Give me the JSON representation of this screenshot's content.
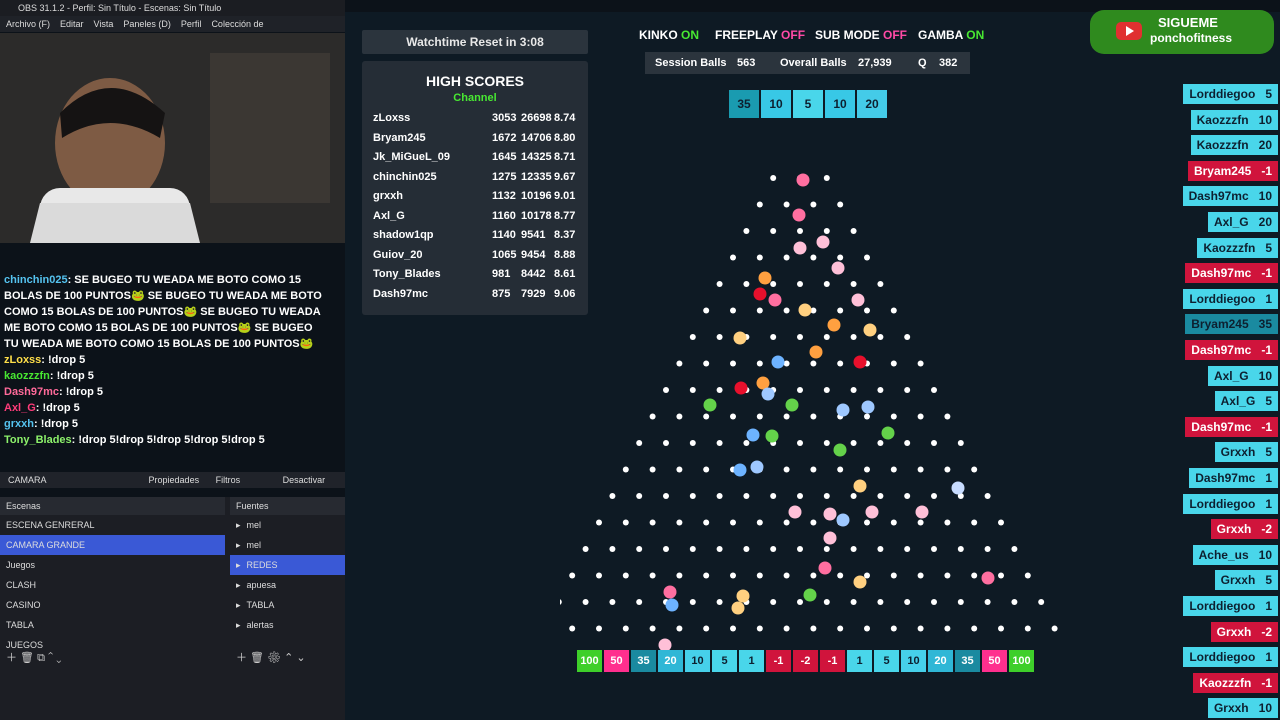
{
  "window": {
    "title": "OBS 31.1.2 - Perfil: Sin Título - Escenas: Sin Título"
  },
  "menu": {
    "items": [
      "Archivo (F)",
      "Editar",
      "Vista",
      "Paneles (D)",
      "Perfil",
      "Colección de Escenas",
      "Herramien"
    ]
  },
  "chat": [
    {
      "user": "chinchin025",
      "text": ": SE BUGEO TU WEADA ME BOTO COMO 15 BOLAS DE 100 PUNTOS🐸 SE BUGEO TU WEADA ME BOTO COMO 15 BOLAS DE 100 PUNTOS🐸 SE BUGEO TU WEADA ME BOTO COMO 15 BOLAS DE 100 PUNTOS🐸 SE BUGEO TU WEADA ME BOTO COMO 15 BOLAS DE 100 PUNTOS🐸",
      "color": "#55c3f0"
    },
    {
      "user": "zLoxss",
      "text": ": !drop 5",
      "color": "#ffdf4a"
    },
    {
      "user": "kaozzzfn",
      "text": ": !drop 5",
      "color": "#48e832"
    },
    {
      "user": "Dash97mc",
      "text": ": !drop 5",
      "color": "#ff6a9a"
    },
    {
      "user": "Axl_G",
      "text": ": !drop 5",
      "color": "#ff3c7a"
    },
    {
      "user": "grxxh",
      "text": ": !drop 5",
      "color": "#55c3f0"
    },
    {
      "user": "Tony_Blades",
      "text": ": !drop 5!drop 5!drop 5!drop 5!drop 5",
      "color": "#8df26b"
    }
  ],
  "scene_toolbar": {
    "source": "CAMARA",
    "props": "Propiedades",
    "filters": "Filtros",
    "deactivate": "Desactivar"
  },
  "scenes": {
    "header": "Escenas",
    "items": [
      "ESCENA GENRERAL",
      "CAMARA GRANDE",
      "Juegos",
      "CLASH",
      "CASINO",
      "TABLA",
      "JUEGOS"
    ],
    "selected": 1
  },
  "sources": {
    "header": "Fuentes",
    "items": [
      "mel",
      "mel",
      "REDES",
      "apuesa",
      "TABLA",
      "alertas"
    ],
    "selected": 2
  },
  "watchtime": "Watchtime Reset in 3:08",
  "scores": {
    "title": "HIGH SCORES",
    "subtitle": "Channel",
    "rows": [
      [
        "zLoxss",
        "3053",
        "26698",
        "8.74"
      ],
      [
        "Bryam245",
        "1672",
        "14706",
        "8.80"
      ],
      [
        "Jk_MiGueL_09",
        "1645",
        "14325",
        "8.71"
      ],
      [
        "chinchin025",
        "1275",
        "12335",
        "9.67"
      ],
      [
        "grxxh",
        "1132",
        "10196",
        "9.01"
      ],
      [
        "Axl_G",
        "1160",
        "10178",
        "8.77"
      ],
      [
        "shadow1qp",
        "1140",
        "9541",
        "8.37"
      ],
      [
        "Guiov_20",
        "1065",
        "9454",
        "8.88"
      ],
      [
        "Tony_Blades",
        "981",
        "8442",
        "8.61"
      ],
      [
        "Dash97mc",
        "875",
        "7929",
        "9.06"
      ]
    ]
  },
  "flags": [
    {
      "label": "KINKO",
      "state": "ON"
    },
    {
      "label": "FREEPLAY",
      "state": "OFF"
    },
    {
      "label": "SUB MODE",
      "state": "OFF"
    },
    {
      "label": "GAMBA",
      "state": "ON"
    }
  ],
  "stats": {
    "session_label": "Session Balls",
    "session": "563",
    "overall_label": "Overall Balls",
    "overall": "27,939",
    "q_label": "Q",
    "q": "382"
  },
  "top_bins": [
    {
      "value": "35",
      "color": "#1a9bb0"
    },
    {
      "value": "10",
      "color": "#38c8e6"
    },
    {
      "value": "5",
      "color": "#49d6ea"
    },
    {
      "value": "10",
      "color": "#38c8e6"
    },
    {
      "value": "20",
      "color": "#44cbe8"
    }
  ],
  "bottom_bins": [
    {
      "value": "100",
      "color": "#3ecf2a"
    },
    {
      "value": "50",
      "color": "#ff2f8e"
    },
    {
      "value": "35",
      "color": "#1a8aa0"
    },
    {
      "value": "20",
      "color": "#2fb7d6"
    },
    {
      "value": "10",
      "color": "#46d0ea"
    },
    {
      "value": "5",
      "color": "#49d6ea"
    },
    {
      "value": "1",
      "color": "#49d6ea"
    },
    {
      "value": "-1",
      "color": "#d0143c"
    },
    {
      "value": "-2",
      "color": "#d0143c"
    },
    {
      "value": "-1",
      "color": "#d0143c"
    },
    {
      "value": "1",
      "color": "#49d6ea"
    },
    {
      "value": "5",
      "color": "#49d6ea"
    },
    {
      "value": "10",
      "color": "#46d0ea"
    },
    {
      "value": "20",
      "color": "#2fb7d6"
    },
    {
      "value": "35",
      "color": "#1a8aa0"
    },
    {
      "value": "50",
      "color": "#ff2f8e"
    },
    {
      "value": "100",
      "color": "#3ecf2a"
    }
  ],
  "follow": {
    "title": "SIGUEME",
    "handle": "ponchofitness"
  },
  "feed": [
    {
      "name": "Lorddiegoo",
      "value": "5",
      "color": "#49d6ea"
    },
    {
      "name": "Kaozzzfn",
      "value": "10",
      "color": "#49d6ea"
    },
    {
      "name": "Kaozzzfn",
      "value": "20",
      "color": "#49d6ea"
    },
    {
      "name": "Bryam245",
      "value": "-1",
      "color": "#d0143c"
    },
    {
      "name": "Dash97mc",
      "value": "10",
      "color": "#49d6ea"
    },
    {
      "name": "Axl_G",
      "value": "20",
      "color": "#49d6ea"
    },
    {
      "name": "Kaozzzfn",
      "value": "5",
      "color": "#49d6ea"
    },
    {
      "name": "Dash97mc",
      "value": "-1",
      "color": "#d0143c"
    },
    {
      "name": "Lorddiegoo",
      "value": "1",
      "color": "#49d6ea"
    },
    {
      "name": "Bryam245",
      "value": "35",
      "color": "#1a8aa0"
    },
    {
      "name": "Dash97mc",
      "value": "-1",
      "color": "#d0143c"
    },
    {
      "name": "Axl_G",
      "value": "10",
      "color": "#49d6ea"
    },
    {
      "name": "Axl_G",
      "value": "5",
      "color": "#49d6ea"
    },
    {
      "name": "Dash97mc",
      "value": "-1",
      "color": "#d0143c"
    },
    {
      "name": "Grxxh",
      "value": "5",
      "color": "#49d6ea"
    },
    {
      "name": "Dash97mc",
      "value": "1",
      "color": "#49d6ea"
    },
    {
      "name": "Lorddiegoo",
      "value": "1",
      "color": "#49d6ea"
    },
    {
      "name": "Grxxh",
      "value": "-2",
      "color": "#d0143c"
    },
    {
      "name": "Ache_us",
      "value": "10",
      "color": "#49d6ea"
    },
    {
      "name": "Grxxh",
      "value": "5",
      "color": "#49d6ea"
    },
    {
      "name": "Lorddiegoo",
      "value": "1",
      "color": "#49d6ea"
    },
    {
      "name": "Grxxh",
      "value": "-2",
      "color": "#d0143c"
    },
    {
      "name": "Lorddiegoo",
      "value": "1",
      "color": "#49d6ea"
    },
    {
      "name": "Kaozzzfn",
      "value": "-1",
      "color": "#d0143c"
    },
    {
      "name": "Grxxh",
      "value": "10",
      "color": "#49d6ea"
    }
  ]
}
